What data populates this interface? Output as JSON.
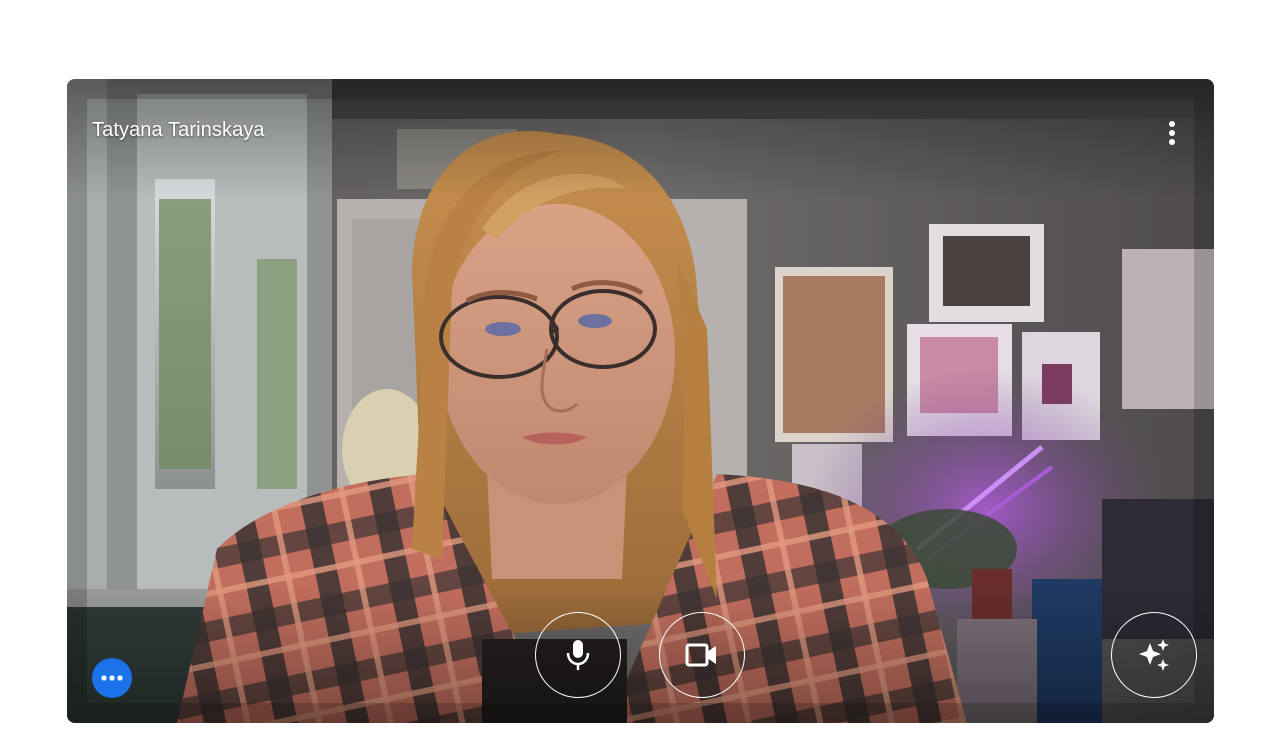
{
  "participant": {
    "name": "Tatyana Tarinskaya"
  },
  "controls": {
    "more_options_icon": "more-vert-icon",
    "microphone_icon": "microphone-icon",
    "camera_icon": "video-camera-icon",
    "effects_icon": "sparkle-effects-icon",
    "extra_options_icon": "more-horiz-icon"
  },
  "colors": {
    "page_background": "#ffffff",
    "control_outline": "#ffffff",
    "options_button": "#1a73e8"
  }
}
